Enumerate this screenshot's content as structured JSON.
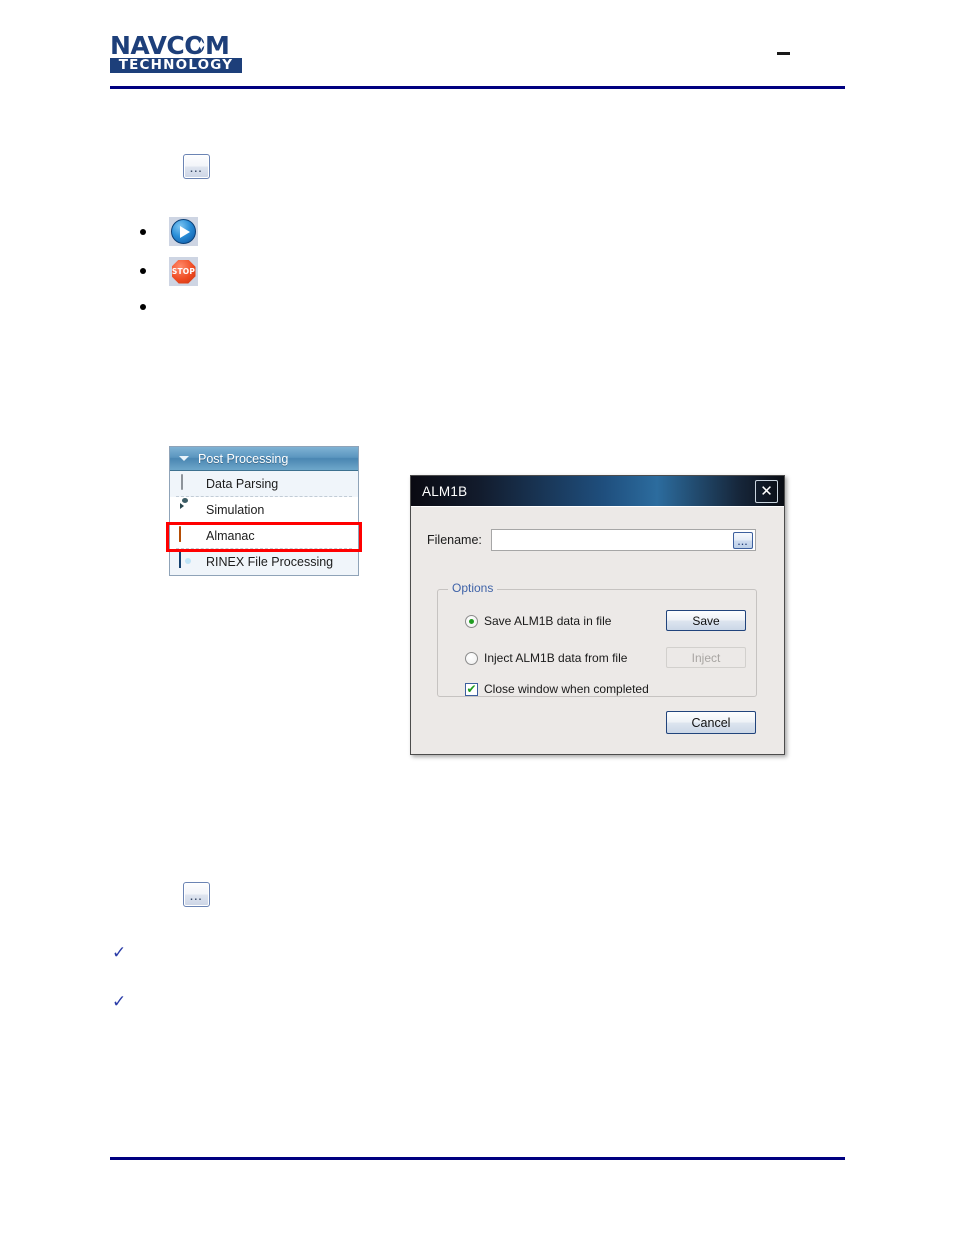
{
  "header": {
    "logo_primary": "NAVCOM",
    "logo_secondary": "TECHNOLOGY",
    "logo_star": "✦",
    "page_marker": "",
    "rule_color": "#000080"
  },
  "figures": {
    "ellipsis_button_label": "...",
    "play_icon_name": "play-icon",
    "stop_icon_label": "STOP",
    "check_bullet_glyph": "✓"
  },
  "post_processing_panel": {
    "header_label": "Post Processing",
    "header_color": "#5b96bf",
    "highlight_color": "#ff0000",
    "items": [
      {
        "label": "Data Parsing",
        "icon": "cube-icon"
      },
      {
        "label": "Simulation",
        "icon": "camera-icon"
      },
      {
        "label": "Almanac",
        "icon": "book-icon"
      },
      {
        "label": "RINEX File Processing",
        "icon": "gear-icon"
      }
    ],
    "selected_item": "Almanac"
  },
  "dialog": {
    "title": "ALM1B",
    "close_label": "✕",
    "filename": {
      "label": "Filename:",
      "value": "",
      "placeholder": "",
      "browse_label": "..."
    },
    "options": {
      "legend": "Options",
      "legend_color": "#3f63a8",
      "save_option": {
        "label": "Save ALM1B data in file",
        "checked": true,
        "button_label": "Save",
        "button_enabled": true
      },
      "inject_option": {
        "label": "Inject ALM1B data from file",
        "checked": false,
        "button_label": "Inject",
        "button_enabled": false
      },
      "close_when_completed": {
        "label": "Close window when completed",
        "checked": true,
        "tick": "✔"
      }
    },
    "cancel_label": "Cancel"
  }
}
